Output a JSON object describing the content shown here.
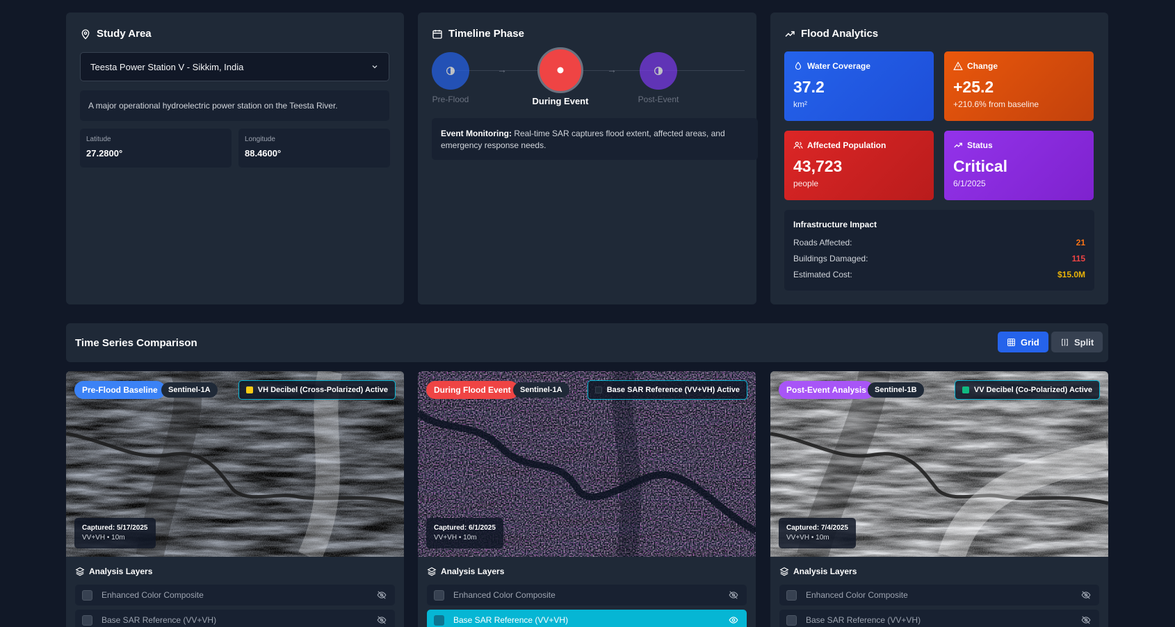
{
  "study_area": {
    "title": "Study Area",
    "location": "Teesta Power Station V - Sikkim, India",
    "description": "A major operational hydroelectric power station on the Teesta River.",
    "latitude_label": "Latitude",
    "latitude": "27.2800°",
    "longitude_label": "Longitude",
    "longitude": "88.4600°"
  },
  "timeline": {
    "title": "Timeline Phase",
    "phases": [
      {
        "label": "Pre-Flood",
        "color": "#3b82f6"
      },
      {
        "label": "During Event",
        "color": "#ef4444"
      },
      {
        "label": "Post-Event",
        "color": "#8b5cf6"
      }
    ],
    "active_index": 1,
    "note_label": "Event Monitoring:",
    "note_text": "Real-time SAR captures flood extent, affected areas, and emergency response needs."
  },
  "analytics": {
    "title": "Flood Analytics",
    "cards": [
      {
        "title": "Water Coverage",
        "value": "37.2",
        "sub": "km²",
        "color": "#1d4ed8"
      },
      {
        "title": "Change",
        "value": "+25.2",
        "sub": "+210.6% from baseline",
        "color": "#ea580c"
      },
      {
        "title": "Affected Population",
        "value": "43,723",
        "sub": "people",
        "color": "#dc2626"
      },
      {
        "title": "Status",
        "value": "Critical",
        "sub": "6/1/2025",
        "color": "#9333ea"
      }
    ],
    "infrastructure": {
      "title": "Infrastructure Impact",
      "rows": [
        {
          "label": "Roads Affected:",
          "value": "21",
          "color": "#f97316"
        },
        {
          "label": "Buildings Damaged:",
          "value": "115",
          "color": "#ef4444"
        },
        {
          "label": "Estimated Cost:",
          "value": "$15.0M",
          "color": "#eab308"
        }
      ]
    }
  },
  "comparison": {
    "title": "Time Series Comparison",
    "grid_label": "Grid",
    "split_label": "Split",
    "panels": [
      {
        "badge": "Pre-Flood Baseline",
        "badge_color": "#3b82f6",
        "satellite": "Sentinel-1A",
        "active_layer": "VH Decibel (Cross-Polarized) Active",
        "active_color": "#facc15",
        "captured": "Captured: 5/17/2025",
        "meta": "VV+VH • 10m"
      },
      {
        "badge": "During Flood Event",
        "badge_color": "#ef4444",
        "satellite": "Sentinel-1A",
        "active_layer": "Base SAR Reference (VV+VH) Active",
        "active_color": "#1f2937",
        "captured": "Captured: 6/1/2025",
        "meta": "VV+VH • 10m"
      },
      {
        "badge": "Post-Event Analysis",
        "badge_color": "#a855f7",
        "satellite": "Sentinel-1B",
        "active_layer": "VV Decibel (Co-Polarized) Active",
        "active_color": "#10b981",
        "captured": "Captured: 7/4/2025",
        "meta": "VV+VH • 10m"
      }
    ],
    "layers_title": "Analysis Layers",
    "layers": [
      "Enhanced Color Composite",
      "Base SAR Reference (VV+VH)"
    ]
  }
}
